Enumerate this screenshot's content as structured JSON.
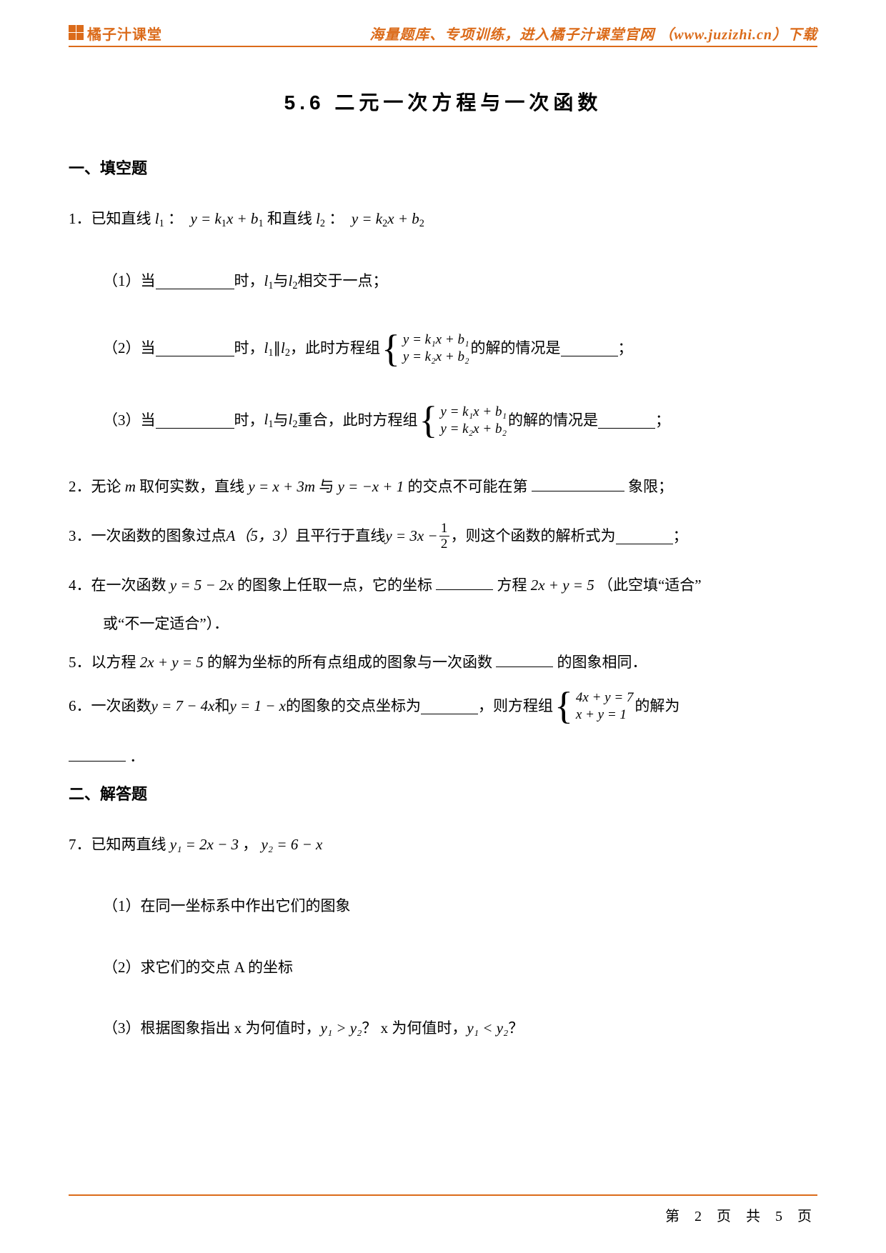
{
  "header": {
    "brand": "橘子汁课堂",
    "tagline": "海量题库、专项训练，进入橘子汁课堂官网 （www.juzizhi.cn）下载"
  },
  "title": "5.6  二元一次方程与一次函数",
  "section1": "一、填空题",
  "q1": {
    "stem_a": "1．已知直线 ",
    "l1": "l",
    "l1s": "1",
    "colon1": "：",
    "eq1_a": "y = k",
    "eq1_b": "1",
    "eq1_c": "x + b",
    "eq1_d": "1",
    "and": " 和直线 ",
    "l2": "l",
    "l2s": "2",
    "colon2": "：",
    "eq2_a": "y = k",
    "eq2_b": "2",
    "eq2_c": "x + b",
    "eq2_d": "2",
    "sub1_a": "（1）当",
    "sub1_b": "时，",
    "sub1_c": " 与 ",
    "sub1_d": " 相交于一点；",
    "sub2_a": "（2）当",
    "sub2_b": "时，",
    "sub2_par": " ∥ ",
    "sub2_c": "，此时方程组",
    "sysA_1": "y = k₁x + b₁",
    "sysA_2": "y = k₂x + b₂",
    "sub2_d": " 的解的情况是",
    "sub2_e": "；",
    "sub3_a": "（3）当",
    "sub3_b": "时，",
    "sub3_c": " 与 ",
    "sub3_d": " 重合，此时方程组",
    "sub3_e": " 的解的情况是",
    "sub3_f": "；"
  },
  "q2_a": "2．无论 ",
  "q2_m": "m",
  "q2_b": " 取何实数，直线 ",
  "q2_eq1": "y = x + 3m",
  "q2_c": " 与 ",
  "q2_eq2": "y = −x + 1",
  "q2_d": " 的交点不可能在第",
  "q2_e": "象限；",
  "q3_a": "3．一次函数的图象过点 ",
  "q3_pt": "A（5，3）",
  "q3_b": "且平行于直线 ",
  "q3_eq_l": "y = 3x − ",
  "q3_fr_n": "1",
  "q3_fr_d": "2",
  "q3_c": "，则这个函数的解析式为",
  "q3_d": "；",
  "q4_a": "4．在一次函数 ",
  "q4_eq1": "y = 5 − 2x",
  "q4_b": " 的图象上任取一点，它的坐标",
  "q4_c": "方程 ",
  "q4_eq2": "2x + y = 5",
  "q4_d": "（此空填“适合”",
  "q4_e": "或“不一定适合”）．",
  "q5_a": "5．以方程 ",
  "q5_eq1": "2x + y = 5",
  "q5_b": " 的解为坐标的所有点组成的图象与一次函数",
  "q5_c": "的图象相同．",
  "q6_a": "6．一次函数 ",
  "q6_eq1": "y = 7 − 4x",
  "q6_b": " 和 ",
  "q6_eq2": "y = 1 − x",
  "q6_c": " 的图象的交点坐标为",
  "q6_d": "，则方程组",
  "q6_sys1": "4x + y = 7",
  "q6_sys2": "x + y = 1",
  "q6_e": " 的解为",
  "q6_f": "．",
  "section2": "二、解答题",
  "q7_a": "7．已知两直线 ",
  "q7_eq1": "y₁ = 2x − 3",
  "q7_c": "，",
  "q7_eq2": "y₂ = 6 − x",
  "q7_s1": "（1）在同一坐标系中作出它们的图象",
  "q7_s2": "（2）求它们的交点 A 的坐标",
  "q7_s3a": "（3）根据图象指出 x 为何值时，",
  "q7_s3y1": "y₁ > y₂",
  "q7_s3b": " ？ x 为何值时，",
  "q7_s3y2": "y₁ < y₂",
  "q7_s3c": " ？",
  "footer": "第 2 页 共 5 页"
}
